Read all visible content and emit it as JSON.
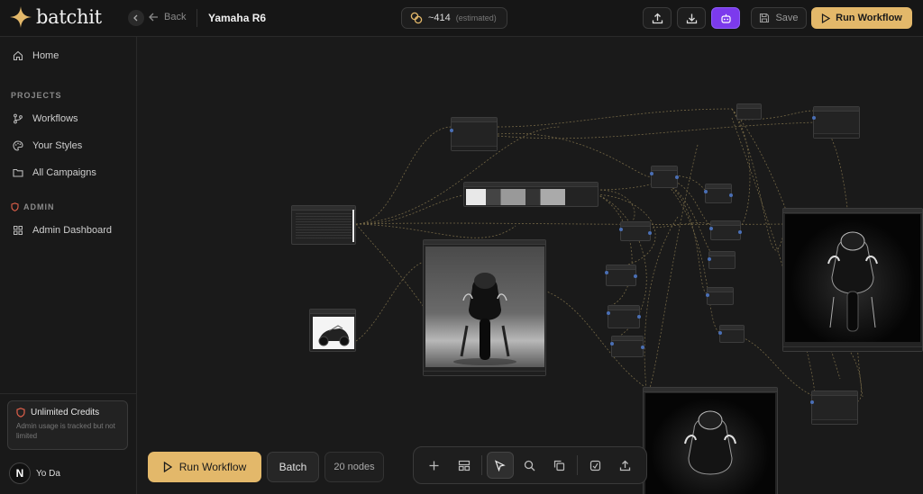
{
  "app": {
    "brand": "batchit",
    "brand_color": "#e3b86a",
    "accent_purple": "#7c3aed"
  },
  "header": {
    "back_label": "Back",
    "title": "Yamaha R6",
    "credits_value": "~414",
    "credits_note": "(estimated)",
    "save_label": "Save",
    "run_label": "Run Workflow",
    "icons": [
      "upload-icon",
      "download-icon",
      "robot-icon",
      "save-icon",
      "play-icon"
    ]
  },
  "sidebar": {
    "home_label": "Home",
    "projects_heading": "PROJECTS",
    "projects": [
      {
        "label": "Workflows",
        "icon": "git-branch-icon"
      },
      {
        "label": "Your Styles",
        "icon": "palette-icon"
      },
      {
        "label": "All Campaigns",
        "icon": "folder-icon"
      }
    ],
    "admin_heading": "ADMIN",
    "admin_items": [
      {
        "label": "Admin Dashboard",
        "icon": "grid-icon"
      }
    ],
    "unlimited_title": "Unlimited Credits",
    "unlimited_sub": "Admin usage is tracked but not limited",
    "user_initial": "N",
    "user_name": "Yo Da"
  },
  "bottom": {
    "run_label": "Run Workflow",
    "batch_label": "Batch",
    "node_count": "20 nodes",
    "tools": [
      "plus-icon",
      "layout-icon",
      "pointer-icon",
      "search-icon",
      "copy-icon",
      "export-icon",
      "upload-icon"
    ]
  }
}
